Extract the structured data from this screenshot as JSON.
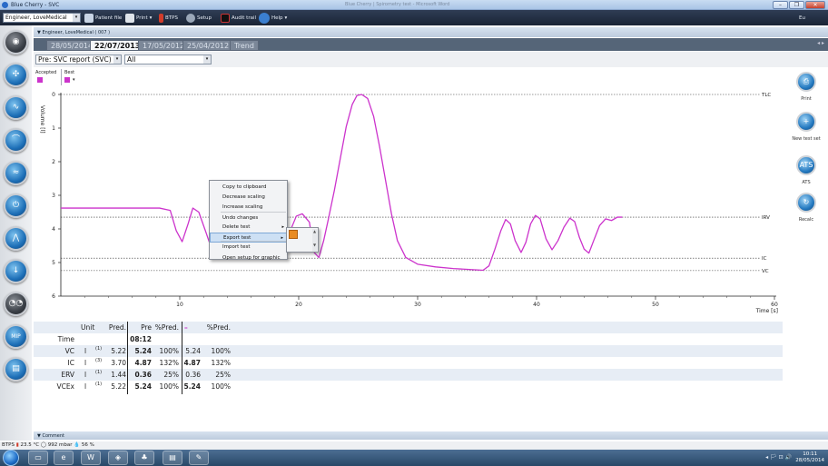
{
  "window": {
    "title": "Blue Cherry - SVC",
    "center_title": "Blue Cherry | Spirometry test - Microsoft Word",
    "min_label": "–",
    "restore_label": "❐",
    "close_label": "✕"
  },
  "toolbar": {
    "user": "Engineer, LoveMedical",
    "patient_file": "Patient file",
    "print": "Print",
    "btps": "BTPS",
    "setup": "Setup",
    "audit_trail": "Audit trail",
    "help": "Help",
    "right_indicator": "Eu",
    "user_dropdown_arrow": "▾",
    "print_dropdown_arrow": "▾",
    "help_dropdown_arrow": "▾"
  },
  "patient_header": {
    "toggle_icon": "▼",
    "label": "Engineer, LoveMedical  ( 007 )"
  },
  "tabs": [
    {
      "label": "28/05/2014",
      "active": false
    },
    {
      "label": "22/07/2013",
      "active": true
    },
    {
      "label": "17/05/2012",
      "active": false
    },
    {
      "label": "25/04/2012",
      "active": false
    },
    {
      "label": "Trend",
      "active": false
    }
  ],
  "tabs_nav": "◂ ▸",
  "filters": {
    "report": "Pre: SVC report (SVC)",
    "scope": "All",
    "dropdown_arrow": "▾"
  },
  "legend": {
    "accepted_label": "Accepted",
    "best_label": "Best",
    "accepted_color": "#cc33cc",
    "best_color": "#cc33cc",
    "best_dropdown": "▾"
  },
  "chart_data": {
    "type": "line",
    "ylabel": "Volume [l]",
    "xlabel": "Time [s]",
    "xlim": [
      0,
      60
    ],
    "ylim": [
      0,
      6
    ],
    "y_inverted": true,
    "xticks": [
      10,
      20,
      30,
      40,
      50,
      60
    ],
    "yticks": [
      0,
      1,
      2,
      3,
      4,
      5,
      6
    ],
    "reference_lines": [
      {
        "label": "TLC",
        "y": 0
      },
      {
        "label": "IRV",
        "y": 3.65
      },
      {
        "label": "IC",
        "y": 4.87
      },
      {
        "label": "VC",
        "y": 5.24
      }
    ],
    "series": [
      {
        "color": "#cc33cc",
        "x": [
          0,
          8.3,
          9.2,
          9.7,
          10.2,
          10.7,
          11.1,
          11.6,
          12.2,
          12.7,
          13.2,
          13.6,
          14.0,
          14.6,
          15.1,
          15.6,
          16.3,
          16.9,
          17.4,
          17.8,
          18.3,
          18.8,
          19.3,
          19.8,
          20.3,
          20.9,
          21.3,
          21.7,
          22.1,
          22.5,
          23.0,
          23.5,
          24.0,
          24.5,
          24.9,
          25.3,
          25.8,
          26.3,
          26.8,
          27.3,
          27.8,
          28.3,
          29.0,
          30.0,
          31.5,
          33.0,
          34.5,
          35.5,
          36.0,
          36.5,
          37.0,
          37.4,
          37.8,
          38.2,
          38.7,
          39.1,
          39.5,
          39.9,
          40.3,
          40.8,
          41.3,
          41.8,
          42.3,
          42.8,
          43.2,
          43.6,
          44.0,
          44.4,
          44.8,
          45.3,
          45.8,
          46.3,
          46.8,
          47.2
        ],
        "y": [
          3.38,
          3.38,
          3.45,
          4.05,
          4.38,
          3.85,
          3.38,
          3.5,
          4.1,
          4.62,
          4.58,
          3.95,
          3.6,
          3.75,
          4.2,
          4.55,
          4.42,
          3.85,
          3.55,
          3.68,
          4.05,
          4.25,
          4.05,
          3.62,
          3.55,
          3.8,
          4.7,
          4.85,
          4.35,
          3.7,
          2.85,
          1.9,
          0.95,
          0.3,
          0.03,
          0.0,
          0.12,
          0.65,
          1.55,
          2.55,
          3.55,
          4.35,
          4.85,
          5.05,
          5.13,
          5.18,
          5.21,
          5.23,
          5.1,
          4.6,
          4.05,
          3.72,
          3.85,
          4.35,
          4.7,
          4.4,
          3.85,
          3.6,
          3.7,
          4.3,
          4.62,
          4.35,
          3.95,
          3.68,
          3.78,
          4.25,
          4.6,
          4.72,
          4.35,
          3.9,
          3.7,
          3.75,
          3.65,
          3.65
        ]
      }
    ]
  },
  "context_menu": {
    "items": [
      {
        "label": "Copy to clipboard",
        "submenu": false,
        "highlight": false
      },
      {
        "label": "Decrease scaling",
        "submenu": false,
        "highlight": false
      },
      {
        "label": "Increase scaling",
        "submenu": false,
        "highlight": false
      },
      {
        "label": "Undo changes",
        "submenu": false,
        "highlight": false
      },
      {
        "label": "Delete test",
        "submenu": true,
        "highlight": false
      },
      {
        "label": "Export test",
        "submenu": true,
        "highlight": true
      },
      {
        "label": "Import test",
        "submenu": false,
        "highlight": false
      },
      {
        "label": "Open setup for graphic",
        "submenu": false,
        "highlight": false
      }
    ],
    "submenu_arrow": "▸",
    "scroll_up": "▲",
    "scroll_down": "▼"
  },
  "table": {
    "headers": {
      "unit": "Unit",
      "pred": "Pred.",
      "pre": "Pre",
      "pct_pred": "%Pred.",
      "post": "–",
      "post_pct_pred": "%Pred."
    },
    "post_color": "#cc33cc",
    "rows": [
      {
        "param": "Time",
        "unit": "",
        "note": "",
        "pred": "",
        "pre": "08:12",
        "pct": "",
        "post": "",
        "post_pct": ""
      },
      {
        "param": "VC",
        "unit": "l",
        "note": "(1)",
        "pred": "5.22",
        "pre": "5.24",
        "pct": "100%",
        "post": "5.24",
        "post_pct": "100%"
      },
      {
        "param": "IC",
        "unit": "l",
        "note": "(3)",
        "pred": "3.70",
        "pre": "4.87",
        "pct": "132%",
        "post": "4.87",
        "post_pct": "132%"
      },
      {
        "param": "ERV",
        "unit": "l",
        "note": "(1)",
        "pred": "1.44",
        "pre": "0.36",
        "pct": "25%",
        "post": "0.36",
        "post_pct": "25%"
      },
      {
        "param": "VCEx",
        "unit": "l",
        "note": "(1)",
        "pred": "5.22",
        "pre": "5.24",
        "pct": "100%",
        "post": "5.24",
        "post_pct": "100%"
      }
    ]
  },
  "right_actions": [
    {
      "label": "Print",
      "glyph": "⎙"
    },
    {
      "label": "New test set",
      "glyph": "+"
    },
    {
      "label": "ATS",
      "glyph": "ATS"
    },
    {
      "label": "Recalc",
      "glyph": "↻"
    }
  ],
  "comment": {
    "toggle_icon": "▼",
    "label": "Comment"
  },
  "status": {
    "btps": "BTPS",
    "temp": "23.5 °C",
    "pressure": "992 mbar",
    "humidity": "56 %"
  },
  "taskbar": {
    "time": "10:11",
    "date": "28/05/2014",
    "tray": "◂ 🏳 ⊡ 🔊"
  }
}
